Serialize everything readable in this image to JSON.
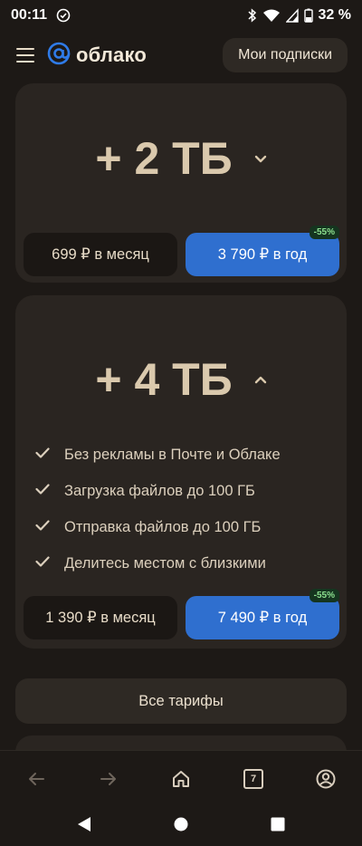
{
  "status_bar": {
    "time": "00:11",
    "battery": "32 %",
    "icons": [
      "sync-icon",
      "bluetooth-icon",
      "wifi-icon",
      "signal-icon",
      "battery-icon"
    ]
  },
  "header": {
    "logo_text": "облако",
    "subscriptions_label": "Мои подписки"
  },
  "plans": [
    {
      "title": "+ 2 ТБ",
      "expanded": false,
      "month_price": "699 ₽ в месяц",
      "year_price": "3 790 ₽ в год",
      "discount": "-55%"
    },
    {
      "title": "+ 4 ТБ",
      "expanded": true,
      "features": [
        "Без рекламы в Почте и Облаке",
        "Загрузка файлов до 100 ГБ",
        "Отправка файлов до 100 ГБ",
        "Делитесь местом с близкими"
      ],
      "month_price": "1 390 ₽ в месяц",
      "year_price": "7 490 ₽ в год",
      "discount": "-55%"
    }
  ],
  "all_plans_label": "Все тарифы",
  "browser_bar": {
    "tab_count": "7",
    "icons": [
      "back-arrow-icon",
      "forward-arrow-icon",
      "home-icon",
      "tabs-icon",
      "account-icon"
    ]
  },
  "system_nav": {
    "icons": [
      "back-triangle-icon",
      "home-circle-icon",
      "recents-square-icon"
    ]
  },
  "colors": {
    "background": "#1d1916",
    "card": "#2a2521",
    "accent_blue": "#2f6fcf",
    "title_beige": "#dac9ad",
    "discount_green": "#8ce08f"
  }
}
